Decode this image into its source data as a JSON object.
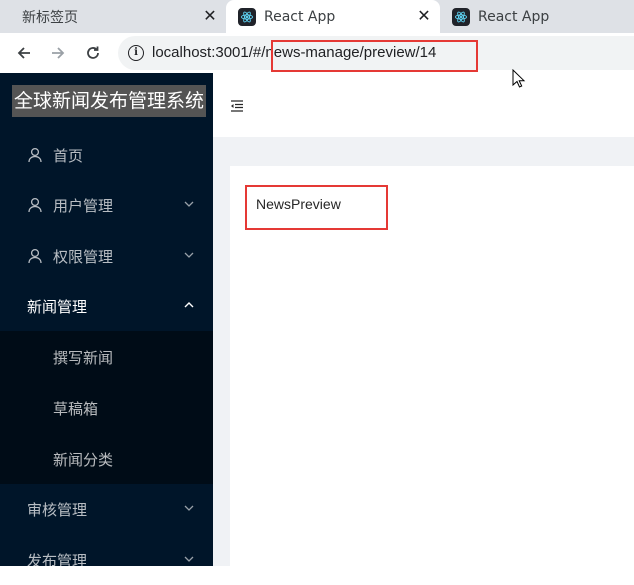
{
  "browser": {
    "tabs": [
      {
        "title": "新标签页",
        "active": false
      },
      {
        "title": "React App",
        "active": true
      },
      {
        "title": "React App",
        "active": false
      }
    ],
    "url_host": "localhost:3001/#/",
    "url_path": "news-manage/preview/14"
  },
  "app": {
    "logo": "全球新闻发布管理系统",
    "menu": [
      {
        "label": "首页",
        "icon": "user-icon",
        "arrow": ""
      },
      {
        "label": "用户管理",
        "icon": "user-icon",
        "arrow": "down"
      },
      {
        "label": "权限管理",
        "icon": "user-icon",
        "arrow": "down"
      },
      {
        "label": "新闻管理",
        "icon": "",
        "arrow": "up"
      }
    ],
    "submenu": [
      {
        "label": "撰写新闻"
      },
      {
        "label": "草稿箱"
      },
      {
        "label": "新闻分类"
      }
    ],
    "menu_after": [
      {
        "label": "审核管理",
        "arrow": "down"
      },
      {
        "label": "发布管理",
        "arrow": "down"
      }
    ],
    "content_text": "NewsPreview"
  },
  "colors": {
    "sider_bg": "#001529",
    "submenu_bg": "#000c17",
    "highlight": "#e53935"
  }
}
